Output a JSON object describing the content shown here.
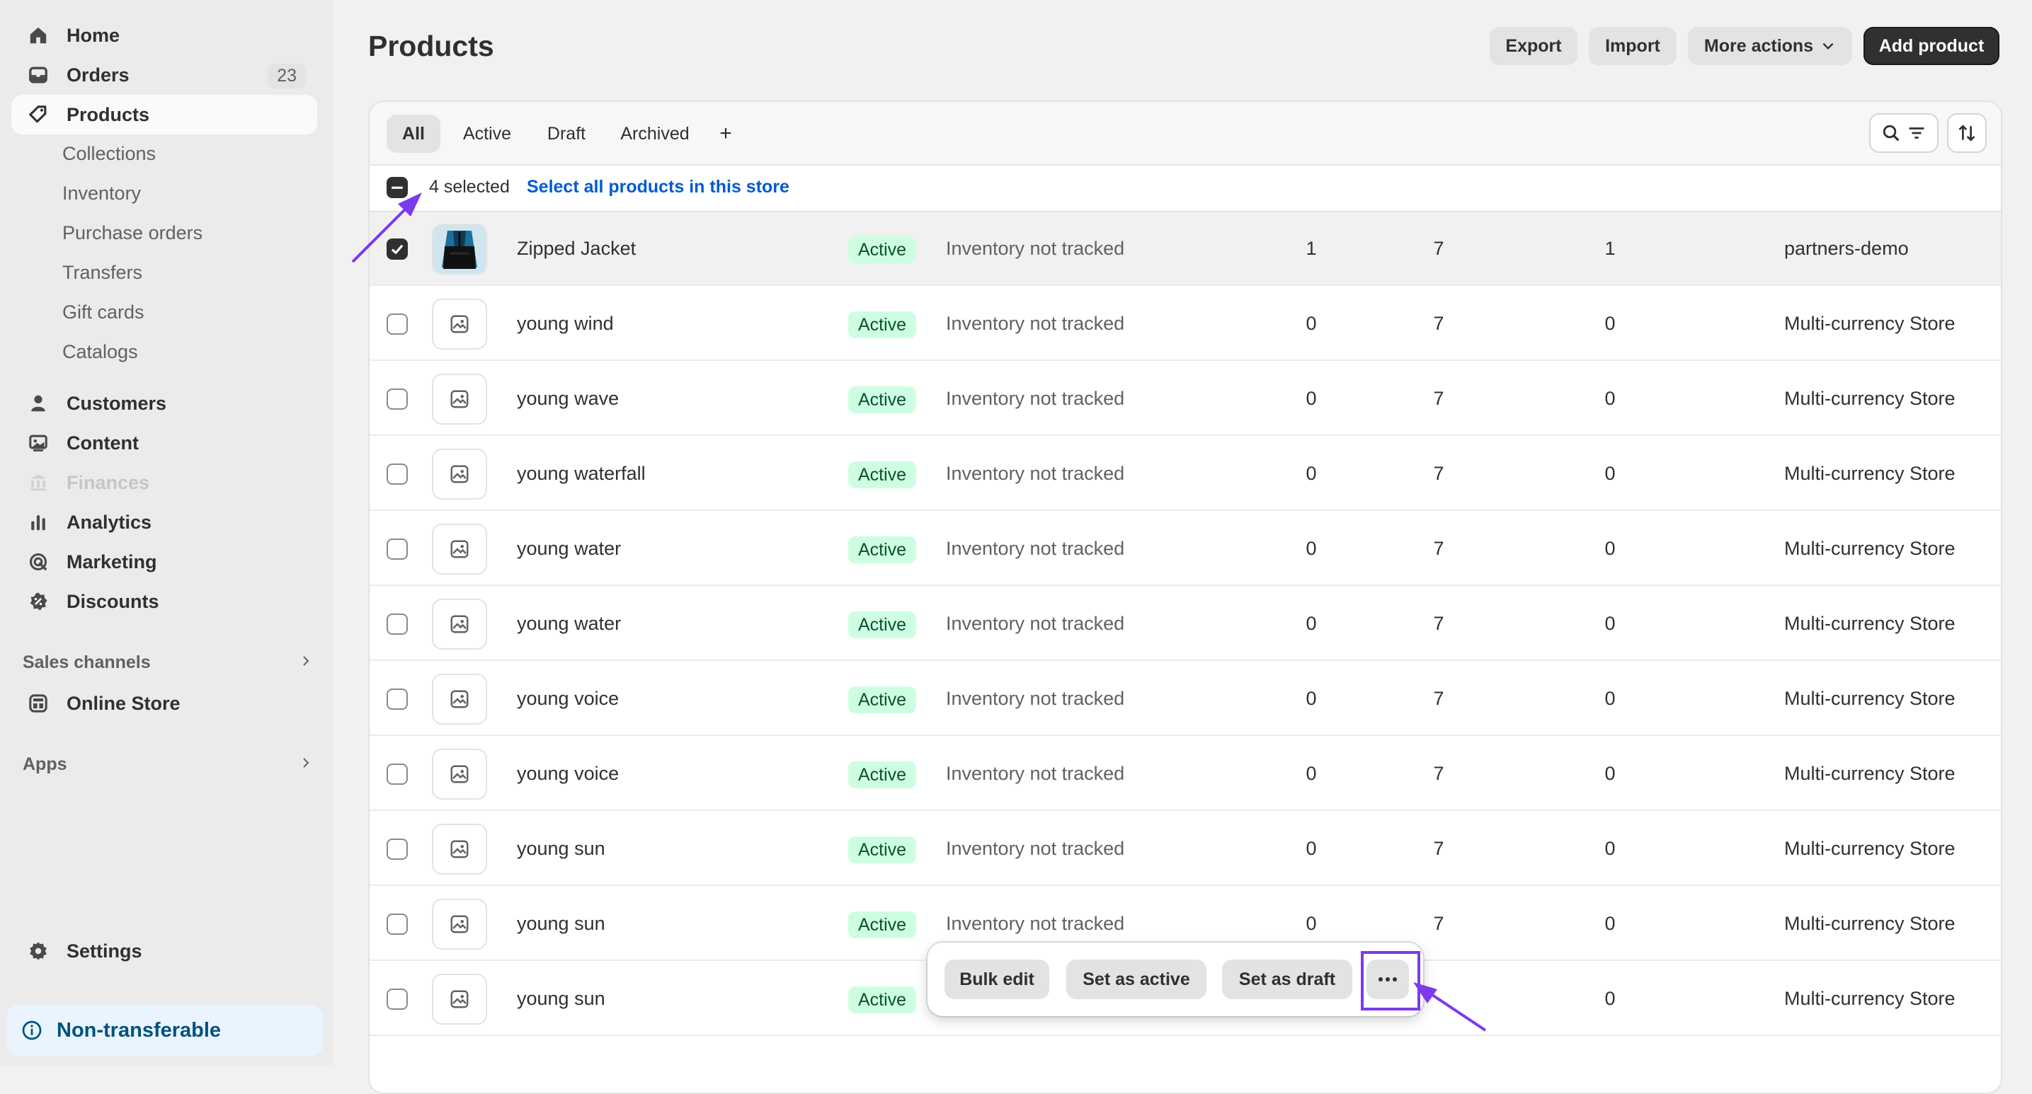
{
  "sidebar": {
    "items": [
      {
        "label": "Home",
        "icon": "home-icon"
      },
      {
        "label": "Orders",
        "icon": "orders-icon",
        "badge": "23"
      },
      {
        "label": "Products",
        "icon": "tag-icon",
        "active": true
      }
    ],
    "sub_items": [
      "Collections",
      "Inventory",
      "Purchase orders",
      "Transfers",
      "Gift cards",
      "Catalogs"
    ],
    "items2": [
      {
        "label": "Customers",
        "icon": "person-icon"
      },
      {
        "label": "Content",
        "icon": "content-icon"
      },
      {
        "label": "Finances",
        "icon": "bank-icon",
        "disabled": true
      },
      {
        "label": "Analytics",
        "icon": "bar-chart-icon"
      },
      {
        "label": "Marketing",
        "icon": "target-icon"
      },
      {
        "label": "Discounts",
        "icon": "discount-icon"
      }
    ],
    "sales_channels_label": "Sales channels",
    "online_store_label": "Online Store",
    "apps_label": "Apps",
    "settings_label": "Settings",
    "non_transferable_label": "Non-transferable"
  },
  "header": {
    "title": "Products",
    "export_label": "Export",
    "import_label": "Import",
    "more_actions_label": "More actions",
    "add_product_label": "Add product"
  },
  "tabs": [
    "All",
    "Active",
    "Draft",
    "Archived",
    "+"
  ],
  "selection": {
    "count_label": "4 selected",
    "select_all_label": "Select all products in this store"
  },
  "rows": [
    {
      "name": "Zipped Jacket",
      "status": "Active",
      "inventory": "Inventory not tracked",
      "c1": "1",
      "c2": "7",
      "c3": "1",
      "vendor": "partners-demo",
      "checked": true,
      "has_image": true
    },
    {
      "name": "young wind",
      "status": "Active",
      "inventory": "Inventory not tracked",
      "c1": "0",
      "c2": "7",
      "c3": "0",
      "vendor": "Multi-currency Store",
      "checked": false
    },
    {
      "name": "young wave",
      "status": "Active",
      "inventory": "Inventory not tracked",
      "c1": "0",
      "c2": "7",
      "c3": "0",
      "vendor": "Multi-currency Store",
      "checked": false
    },
    {
      "name": "young waterfall",
      "status": "Active",
      "inventory": "Inventory not tracked",
      "c1": "0",
      "c2": "7",
      "c3": "0",
      "vendor": "Multi-currency Store",
      "checked": false
    },
    {
      "name": "young water",
      "status": "Active",
      "inventory": "Inventory not tracked",
      "c1": "0",
      "c2": "7",
      "c3": "0",
      "vendor": "Multi-currency Store",
      "checked": false
    },
    {
      "name": "young water",
      "status": "Active",
      "inventory": "Inventory not tracked",
      "c1": "0",
      "c2": "7",
      "c3": "0",
      "vendor": "Multi-currency Store",
      "checked": false
    },
    {
      "name": "young voice",
      "status": "Active",
      "inventory": "Inventory not tracked",
      "c1": "0",
      "c2": "7",
      "c3": "0",
      "vendor": "Multi-currency Store",
      "checked": false
    },
    {
      "name": "young voice",
      "status": "Active",
      "inventory": "Inventory not tracked",
      "c1": "0",
      "c2": "7",
      "c3": "0",
      "vendor": "Multi-currency Store",
      "checked": false
    },
    {
      "name": "young sun",
      "status": "Active",
      "inventory": "Inventory not tracked",
      "c1": "0",
      "c2": "7",
      "c3": "0",
      "vendor": "Multi-currency Store",
      "checked": false
    },
    {
      "name": "young sun",
      "status": "Active",
      "inventory": "Inventory not tracked",
      "c1": "0",
      "c2": "7",
      "c3": "0",
      "vendor": "Multi-currency Store",
      "checked": false
    },
    {
      "name": "young sun",
      "status": "Active",
      "inventory": "",
      "c1": "",
      "c2": "",
      "c3": "0",
      "vendor": "Multi-currency Store",
      "checked": false
    }
  ],
  "bulk_actions": {
    "bulk_edit_label": "Bulk edit",
    "set_active_label": "Set as active",
    "set_draft_label": "Set as draft"
  },
  "colors": {
    "accent": "#7c3aed",
    "primary_button": "#303030",
    "active_badge_bg": "#cdfee1",
    "active_badge_text": "#0c5132",
    "link": "#005bd3"
  }
}
